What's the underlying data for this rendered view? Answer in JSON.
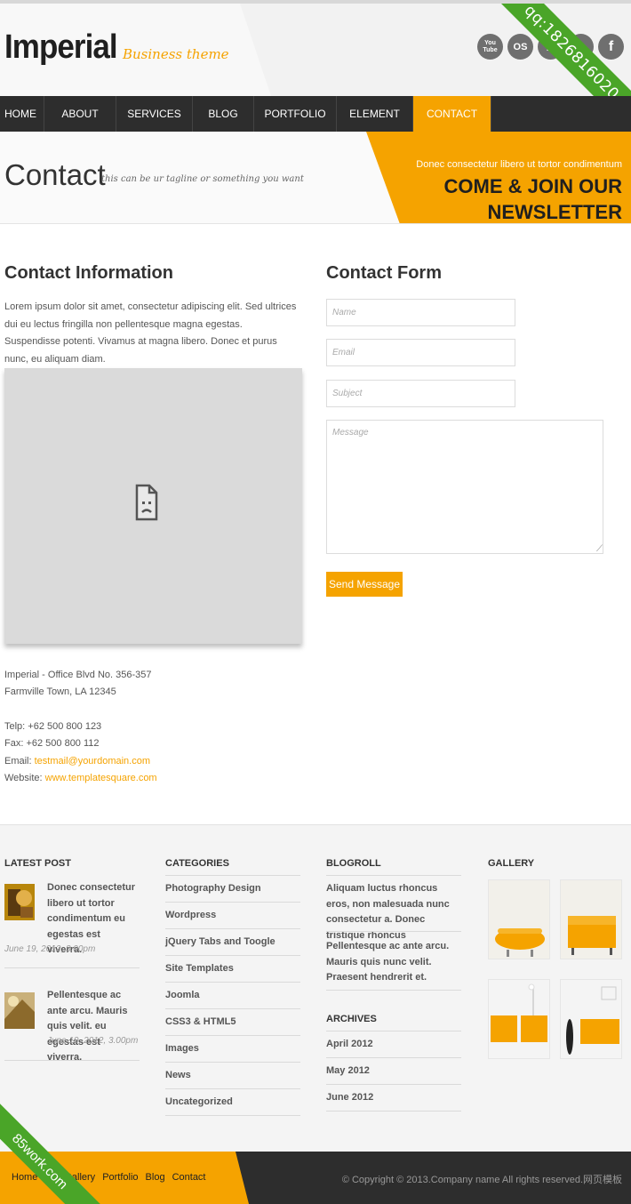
{
  "header": {
    "logo": "Imperial",
    "logo_sub": "Business theme",
    "social_icons": [
      "youtube-icon",
      "lastfm-icon",
      "pinterest-icon",
      "twitter-icon",
      "facebook-icon"
    ],
    "social_labels": [
      "You Tube",
      "OS",
      "P",
      "t",
      "f"
    ],
    "ribbon_text": "qq:1826816020"
  },
  "nav": {
    "items": [
      "HOME",
      "ABOUT",
      "SERVICES",
      "BLOG",
      "PORTFOLIO",
      "ELEMENT",
      "CONTACT"
    ],
    "active": "CONTACT"
  },
  "title_band": {
    "title": "Contact",
    "tagline": "this can be ur tagline or something you want",
    "newsletter_small": "Donec consectetur libero ut tortor condimentum",
    "newsletter_big": "COME & JOIN OUR NEWSLETTER"
  },
  "contact_info": {
    "heading": "Contact Information",
    "text": "Lorem ipsum dolor sit amet, consectetur adipiscing elit. Sed ultrices dui eu lectus fringilla non pellentesque magna egestas. Suspendisse potenti. Vivamus at magna libero. Donec et purus nunc, eu aliquam diam.",
    "address_line1": "Imperial - Office Blvd No. 356-357",
    "address_line2": "Farmville Town, LA 12345",
    "telp": "Telp: +62 500 800 123",
    "fax": "Fax: +62 500 800 112",
    "email_label": "Email: ",
    "email": "testmail@yourdomain.com",
    "website_label": "Website: ",
    "website": "www.templatesquare.com"
  },
  "contact_form": {
    "heading": "Contact Form",
    "name_placeholder": "Name",
    "email_placeholder": "Email",
    "subject_placeholder": "Subject",
    "message_placeholder": "Message",
    "submit": "Send Message"
  },
  "footer": {
    "latest_post_heading": "LATEST POST",
    "posts": [
      {
        "title": "Donec consectetur libero ut tortor condimentum eu egestas est viverra.",
        "date": "June 19, 2012, 3.00pm"
      },
      {
        "title": "Pellentesque ac ante arcu. Mauris quis velit. eu egestas est viverra.",
        "date": "June 19, 2012, 3.00pm"
      }
    ],
    "categories_heading": "CATEGORIES",
    "categories": [
      "Photography Design",
      "Wordpress",
      "jQuery Tabs and Toogle",
      "Site Templates",
      "Joomla",
      "CSS3 & HTML5",
      "Images",
      "News",
      "Uncategorized"
    ],
    "blogroll_heading": "BLOGROLL",
    "blogroll": [
      "Aliquam luctus rhoncus eros, non malesuada nunc consectetur a. Donec tristique rhoncus",
      "Pellentesque ac ante arcu. Mauris quis nunc velit. Praesent hendrerit et."
    ],
    "archives_heading": "ARCHIVES",
    "archives": [
      "April 2012",
      "May 2012",
      "June 2012"
    ],
    "gallery_heading": "GALLERY"
  },
  "bottom": {
    "links": [
      "Home",
      "Gallery",
      "Portfolio",
      "Blog",
      "Contact"
    ],
    "copyright": "© Copyright © 2013.Company name All rights reserved.网页模板",
    "ribbon_text": "85work.com"
  },
  "colors": {
    "accent": "#f5a300",
    "dark": "#2d2d2d",
    "ribbon": "#4aa528"
  }
}
